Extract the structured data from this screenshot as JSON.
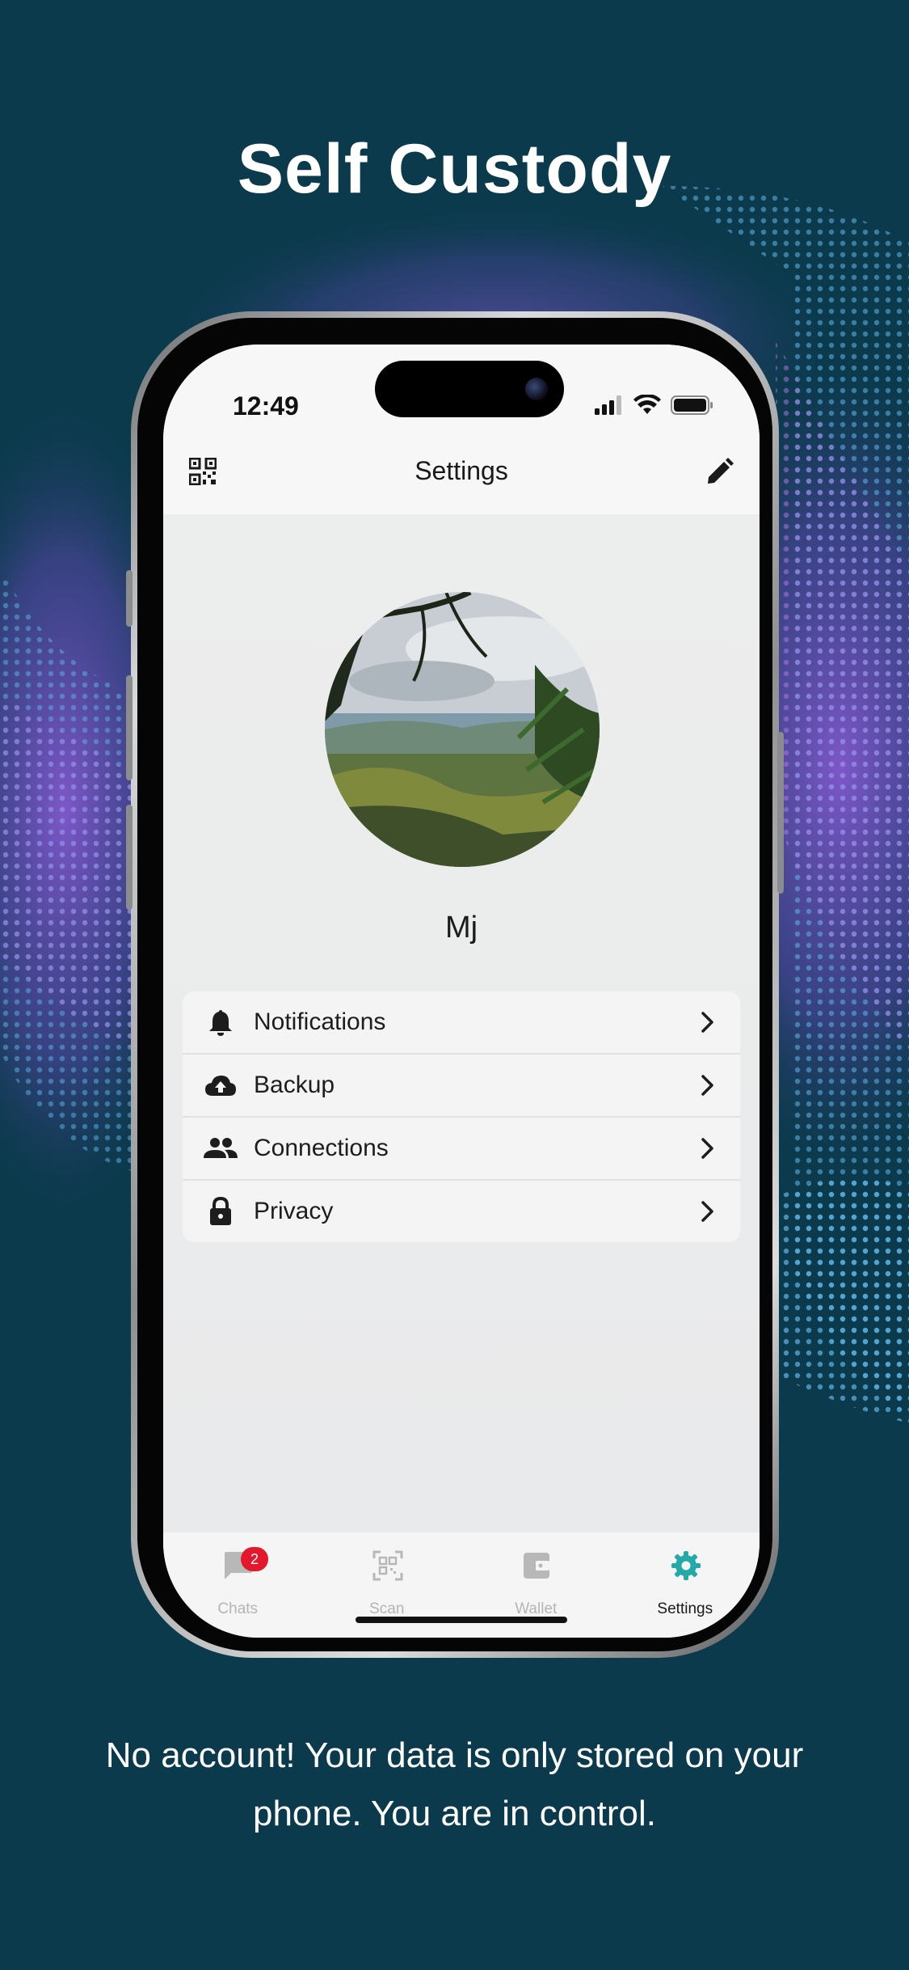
{
  "headline": "Self Custody",
  "caption": "No account! Your data is only stored on your phone. You are in control.",
  "status_bar": {
    "time": "12:49"
  },
  "nav": {
    "title": "Settings",
    "left_icon": "qr-code-icon",
    "right_icon": "pencil-icon"
  },
  "profile": {
    "name": "Mj"
  },
  "menu": [
    {
      "label": "Notifications",
      "icon": "bell-icon"
    },
    {
      "label": "Backup",
      "icon": "cloud-upload-icon"
    },
    {
      "label": "Connections",
      "icon": "people-icon"
    },
    {
      "label": "Privacy",
      "icon": "lock-icon"
    }
  ],
  "tabs": [
    {
      "label": "Chats",
      "icon": "chat-icon",
      "badge": "2"
    },
    {
      "label": "Scan",
      "icon": "scan-icon"
    },
    {
      "label": "Wallet",
      "icon": "wallet-icon"
    },
    {
      "label": "Settings",
      "icon": "gear-icon",
      "active": true
    }
  ],
  "colors": {
    "background": "#0b3a4c",
    "accent": "#22a9a8",
    "badge": "#e3182d"
  }
}
